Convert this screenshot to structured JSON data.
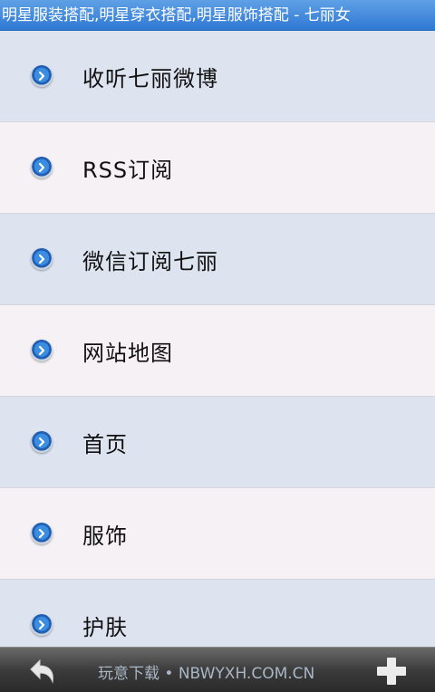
{
  "window": {
    "title": "明星服装搭配,明星穿衣搭配,明星服饰搭配 - 七丽女"
  },
  "menu": {
    "items": [
      {
        "label": "收听七丽微博"
      },
      {
        "label": "RSS订阅"
      },
      {
        "label": "微信订阅七丽"
      },
      {
        "label": "网站地图"
      },
      {
        "label": "首页"
      },
      {
        "label": "服饰"
      },
      {
        "label": "护肤"
      }
    ],
    "bullet_icon": "chevron-right-circle-icon"
  },
  "bottom_bar": {
    "back_icon": "back-arrow-icon",
    "add_icon": "plus-icon",
    "watermark": "玩意下载 • NBWYXH.COM.CN"
  },
  "colors": {
    "titlebar": "#2f78d4",
    "row_odd": "#dde3ef",
    "row_even": "#f6f1f4",
    "bottombar": "#3c3c3c"
  }
}
